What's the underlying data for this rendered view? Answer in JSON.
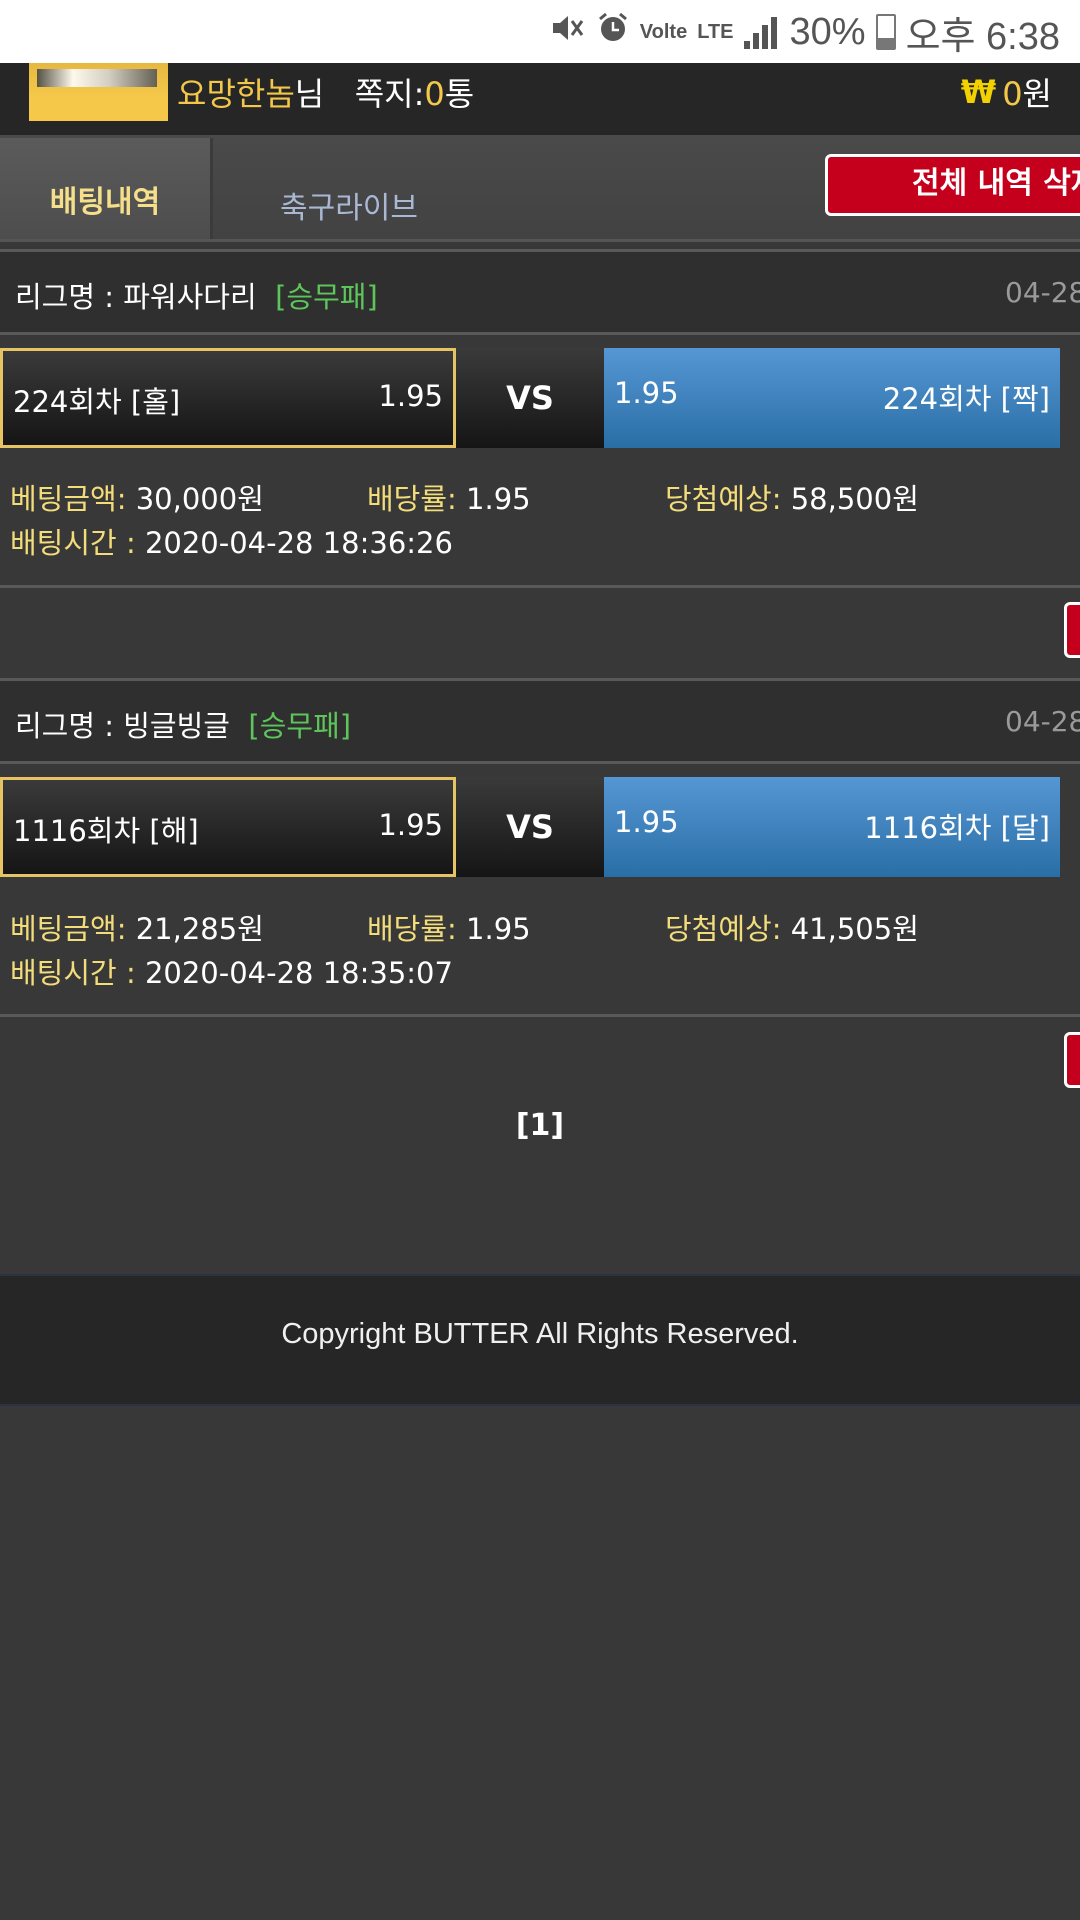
{
  "status_bar": {
    "battery": "30%",
    "time": "오후 6:38",
    "volte_label": "Volte",
    "lte_label": "LTE",
    "icons": [
      "mute-icon",
      "alarm-icon",
      "volte-icon",
      "lte-icon",
      "signal-icon",
      "battery-icon"
    ]
  },
  "header": {
    "username": "요망한놈",
    "honorific": "님",
    "messages_label": "쪽지:",
    "messages_count": "0",
    "messages_unit": "통",
    "currency_symbol": "₩",
    "balance": "0",
    "balance_unit": "원"
  },
  "tabs": {
    "active": "배팅내역",
    "other": "축구라이브",
    "delete_all": "전체 내역 삭제"
  },
  "bets": [
    {
      "league_label": "리그명 : ",
      "league_name": "파워사다리",
      "bet_type": "[승무패]",
      "date": "04-28",
      "left_name": "224회차 [홀]",
      "left_odds": "1.95",
      "vs": "VS",
      "right_odds": "1.95",
      "right_name": "224회차 [짝]",
      "amount_label": "베팅금액:",
      "amount": "30,000원",
      "odds_label": "배당률:",
      "odds": "1.95",
      "expected_label": "당첨예상:",
      "expected": "58,500원",
      "time_label": "배팅시간 :",
      "time": "2020-04-28 18:36:26"
    },
    {
      "league_label": "리그명 : ",
      "league_name": "빙글빙글",
      "bet_type": "[승무패]",
      "date": "04-28",
      "left_name": "1116회차 [해]",
      "left_odds": "1.95",
      "vs": "VS",
      "right_odds": "1.95",
      "right_name": "1116회차 [달]",
      "amount_label": "베팅금액:",
      "amount": "21,285원",
      "odds_label": "배당률:",
      "odds": "1.95",
      "expected_label": "당첨예상:",
      "expected": "41,505원",
      "time_label": "배팅시간 :",
      "time": "2020-04-28 18:35:07"
    }
  ],
  "pagination": {
    "current": "[1]"
  },
  "footer": {
    "copyright": "Copyright BUTTER All Rights Reserved."
  },
  "colors": {
    "accent_yellow": "#f3c74a",
    "bet_type_green": "#5ec55a",
    "delete_red": "#c4001c",
    "right_blue": "#3f86c4",
    "label_yellow": "#f3dc7a"
  }
}
